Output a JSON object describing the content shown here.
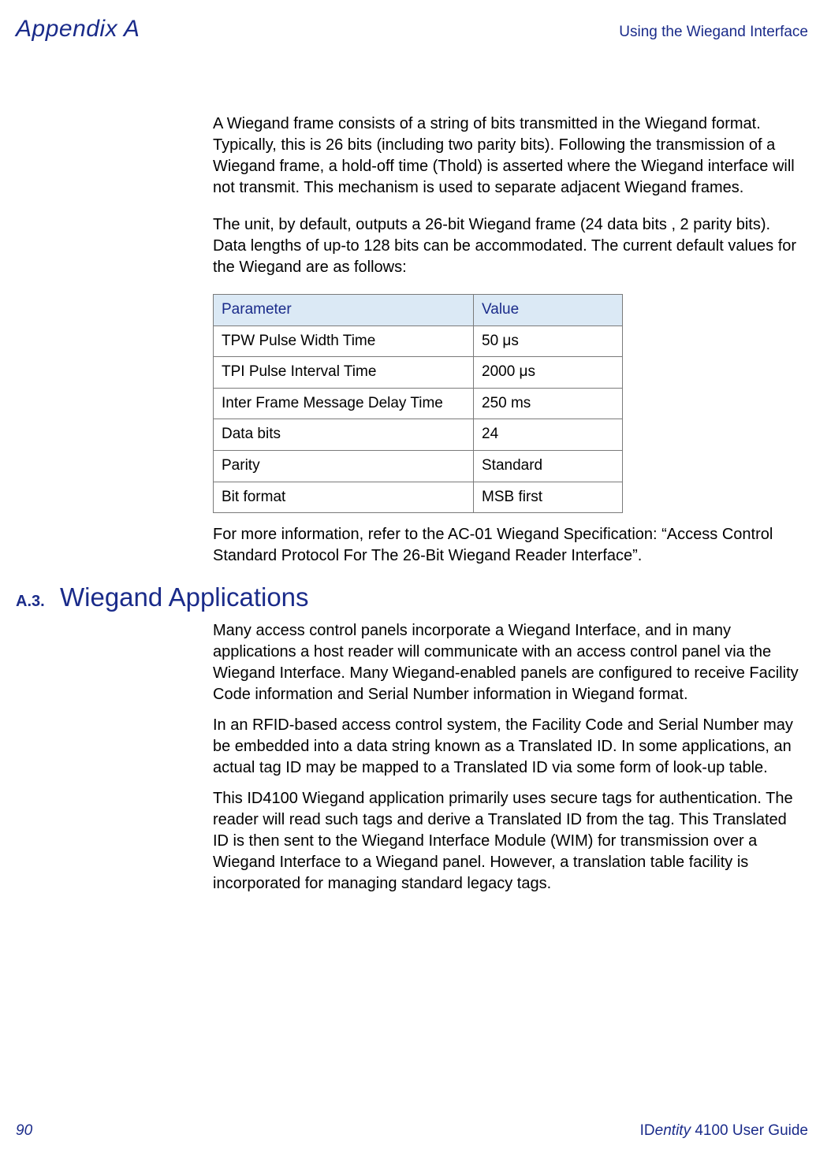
{
  "header": {
    "appendix": "Appendix A",
    "right": "Using the Wiegand Interface"
  },
  "intro": {
    "p1": "A Wiegand frame consists of a string of bits transmitted in the Wiegand format. Typically, this is 26 bits (including two parity bits). Following the transmission of a Wiegand frame, a hold-off time (Thold) is asserted where the Wiegand interface will not transmit. This mechanism is used to separate adjacent Wiegand frames.",
    "p2": "The unit, by default, outputs a 26-bit Wiegand frame (24 data bits , 2 parity bits). Data lengths of up-to 128 bits can be accommodated. The current default values for the Wiegand are as follows:"
  },
  "table": {
    "head_parameter": "Parameter",
    "head_value": "Value",
    "rows": [
      {
        "param": "TPW Pulse Width Time",
        "value": "50 μs"
      },
      {
        "param": "TPI Pulse Interval Time",
        "value": "2000 μs"
      },
      {
        "param": "Inter Frame Message Delay Time",
        "value": "250 ms"
      },
      {
        "param": "Data bits",
        "value": "24"
      },
      {
        "param": "Parity",
        "value": "Standard"
      },
      {
        "param": "Bit format",
        "value": "MSB first"
      }
    ]
  },
  "after_table": "For more information, refer to the AC-01 Wiegand Specification: “Access Control Standard Protocol For The 26-Bit Wiegand Reader Interface”.",
  "section": {
    "num": "A.3.",
    "title": "Wiegand Applications",
    "p1": "Many access control panels incorporate a Wiegand Interface, and in many applications a host reader will communicate with an access control panel via the Wiegand Interface. Many Wiegand-enabled panels are configured to receive Facility Code information and Serial Number information in Wiegand format.",
    "p2": "In an RFID-based access control system, the Facility Code and Serial Number may be embedded into a data string known as a Translated ID. In some applications, an actual tag ID may be mapped to a Translated ID via some form of look-up table.",
    "p3": "This ID4100 Wiegand application primarily uses secure tags for authentication. The reader will read such tags and derive a Translated ID from the tag. This Translated ID is then sent to the Wiegand Interface Module (WIM) for transmission over a Wiegand Interface to a Wiegand panel. However, a translation table facility is incorporated for managing standard legacy tags."
  },
  "footer": {
    "page": "90",
    "right_prefix": "ID",
    "right_italic": "entity",
    "right_suffix": " 4100 User Guide"
  }
}
